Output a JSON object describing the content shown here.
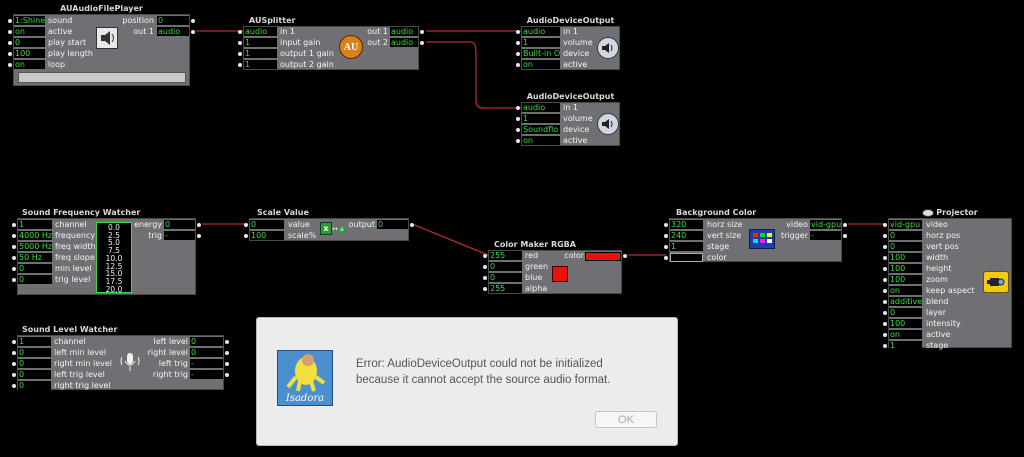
{
  "file_player": {
    "title": "AUAudioFilePlayer",
    "inputs": [
      {
        "value": "1:Shine",
        "label": "sound"
      },
      {
        "value": "on",
        "label": "active"
      },
      {
        "value": "0",
        "label": "play start"
      },
      {
        "value": "100",
        "label": "play length"
      },
      {
        "value": "on",
        "label": "loop"
      }
    ],
    "outputs": [
      {
        "label": "position",
        "value": "0"
      },
      {
        "label": "out 1",
        "value": "audio"
      }
    ]
  },
  "splitter": {
    "title": "AUSplitter",
    "inputs": [
      {
        "value": "audio",
        "label": "in 1"
      },
      {
        "value": "1",
        "label": "input gain"
      },
      {
        "value": "1",
        "label": "output 1 gain"
      },
      {
        "value": "1",
        "label": "output 2 gain"
      }
    ],
    "outputs": [
      {
        "label": "out 1",
        "value": "audio"
      },
      {
        "label": "out 2",
        "value": "audio"
      }
    ],
    "icon_text": "AU"
  },
  "output1": {
    "title": "AudioDeviceOutput",
    "inputs": [
      {
        "value": "audio",
        "label": "in 1"
      },
      {
        "value": "1",
        "label": "volume"
      },
      {
        "value": "Built-in O",
        "label": "device"
      },
      {
        "value": "on",
        "label": "active"
      }
    ]
  },
  "output2": {
    "title": "AudioDeviceOutput",
    "inputs": [
      {
        "value": "audio",
        "label": "in 1"
      },
      {
        "value": "1",
        "label": "volume"
      },
      {
        "value": "Soundflo",
        "label": "device"
      },
      {
        "value": "on",
        "label": "active"
      }
    ]
  },
  "freq_watcher": {
    "title": "Sound Frequency Watcher",
    "inputs": [
      {
        "value": "1",
        "label": "channel"
      },
      {
        "value": "4000 Hz",
        "label": "frequency"
      },
      {
        "value": "5000 Hz",
        "label": "freq width"
      },
      {
        "value": "50 Hz",
        "label": "freq slope"
      },
      {
        "value": "0",
        "label": "min level"
      },
      {
        "value": "0",
        "label": "trig level"
      }
    ],
    "outputs": [
      {
        "label": "energy",
        "value": "0"
      },
      {
        "label": "trig",
        "value": "-"
      }
    ],
    "scale": [
      "0.0",
      "2.5",
      "5.0",
      "7.5",
      "10.0",
      "12.5",
      "15.0",
      "17.5",
      "20.0"
    ]
  },
  "scale_value": {
    "title": "Scale Value",
    "inputs": [
      {
        "value": "0",
        "label": "value"
      },
      {
        "value": "100",
        "label": "scale%"
      }
    ],
    "outputs": [
      {
        "label": "output",
        "value": "0"
      }
    ],
    "icon_text": "x",
    "icon_arrow": "↔",
    "icon_text2": "a"
  },
  "color_maker": {
    "title": "Color Maker RGBA",
    "inputs": [
      {
        "value": "255",
        "label": "red"
      },
      {
        "value": "0",
        "label": "green"
      },
      {
        "value": "0",
        "label": "blue"
      },
      {
        "value": "255",
        "label": "alpha"
      }
    ],
    "outputs": [
      {
        "label": "color"
      }
    ],
    "swatch_color": "#e8140c"
  },
  "bg_color": {
    "title": "Background Color",
    "inputs": [
      {
        "value": "320",
        "label": "horz size"
      },
      {
        "value": "240",
        "label": "vert size"
      },
      {
        "value": "1",
        "label": "stage"
      },
      {
        "value": "",
        "label": "color"
      }
    ],
    "outputs": [
      {
        "label": "video",
        "value": "vid-gpu"
      },
      {
        "label": "trigger",
        "value": "-"
      }
    ]
  },
  "projector": {
    "title": "Projector",
    "inputs": [
      {
        "value": "vid-gpu",
        "label": "video"
      },
      {
        "value": "0",
        "label": "horz pos"
      },
      {
        "value": "0",
        "label": "vert pos"
      },
      {
        "value": "100",
        "label": "width"
      },
      {
        "value": "100",
        "label": "height"
      },
      {
        "value": "100",
        "label": "zoom"
      },
      {
        "value": "on",
        "label": "keep aspect"
      },
      {
        "value": "additive",
        "label": "blend"
      },
      {
        "value": "0",
        "label": "layer"
      },
      {
        "value": "100",
        "label": "intensity"
      },
      {
        "value": "on",
        "label": "active"
      },
      {
        "value": "1",
        "label": "stage"
      }
    ]
  },
  "level_watcher": {
    "title": "Sound Level Watcher",
    "inputs": [
      {
        "value": "1",
        "label": "channel"
      },
      {
        "value": "0",
        "label": "left min level"
      },
      {
        "value": "0",
        "label": "right min level"
      },
      {
        "value": "0",
        "label": "left trig level"
      },
      {
        "value": "0",
        "label": "right trig level"
      }
    ],
    "outputs": [
      {
        "label": "left level",
        "value": "0"
      },
      {
        "label": "right level",
        "value": "0"
      },
      {
        "label": "left trig",
        "value": "-"
      },
      {
        "label": "right trig",
        "value": "-"
      }
    ]
  },
  "dialog": {
    "message_line1": "Error: AudioDeviceOutput could not be initialized",
    "message_line2": "because it cannot accept the source audio format.",
    "ok_label": "OK",
    "logo_text": "Isadora"
  },
  "colors": {
    "background": "#000000",
    "actor_panel": "#707074",
    "value_text": "#3fdc3f",
    "wire": "#b32e2e",
    "projector_icon": "#f2cb10"
  }
}
